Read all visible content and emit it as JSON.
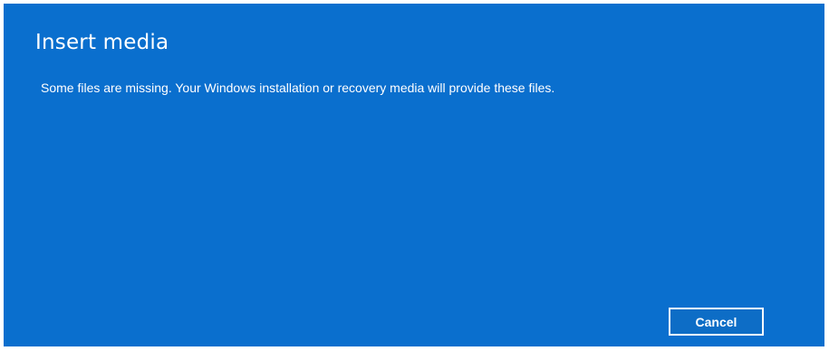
{
  "dialog": {
    "title": "Insert media",
    "message": "Some files are missing. Your Windows installation or recovery media will provide these files.",
    "cancel_label": "Cancel"
  },
  "colors": {
    "background": "#0a6fce",
    "text": "#ffffff"
  }
}
